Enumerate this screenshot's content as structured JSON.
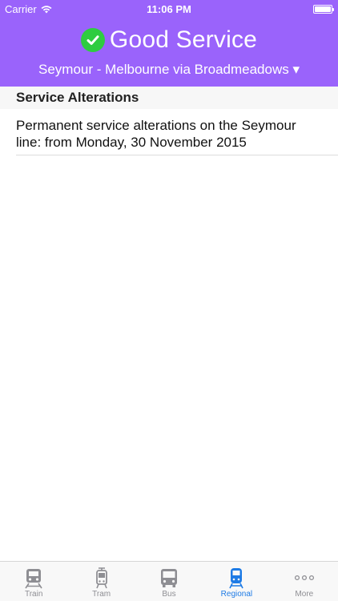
{
  "status_bar": {
    "carrier": "Carrier",
    "time": "11:06 PM"
  },
  "header": {
    "status_text": "Good Service",
    "status_icon": "check-circle-icon",
    "line_selector": "Seymour - Melbourne via Broadmeadows ▾",
    "colors": {
      "background": "#9a63fb",
      "status_icon": "#2ecc40"
    }
  },
  "section": {
    "title": "Service Alterations"
  },
  "alerts": [
    {
      "text": "Permanent service alterations on the Seymour line: from Monday, 30 November 2015"
    }
  ],
  "tab_bar": {
    "active": "Regional",
    "active_color": "#1e7be5",
    "tabs": [
      {
        "label": "Train",
        "icon": "train-icon"
      },
      {
        "label": "Tram",
        "icon": "tram-icon"
      },
      {
        "label": "Bus",
        "icon": "bus-icon"
      },
      {
        "label": "Regional",
        "icon": "regional-train-icon"
      },
      {
        "label": "More",
        "icon": "more-dots-icon"
      }
    ]
  }
}
